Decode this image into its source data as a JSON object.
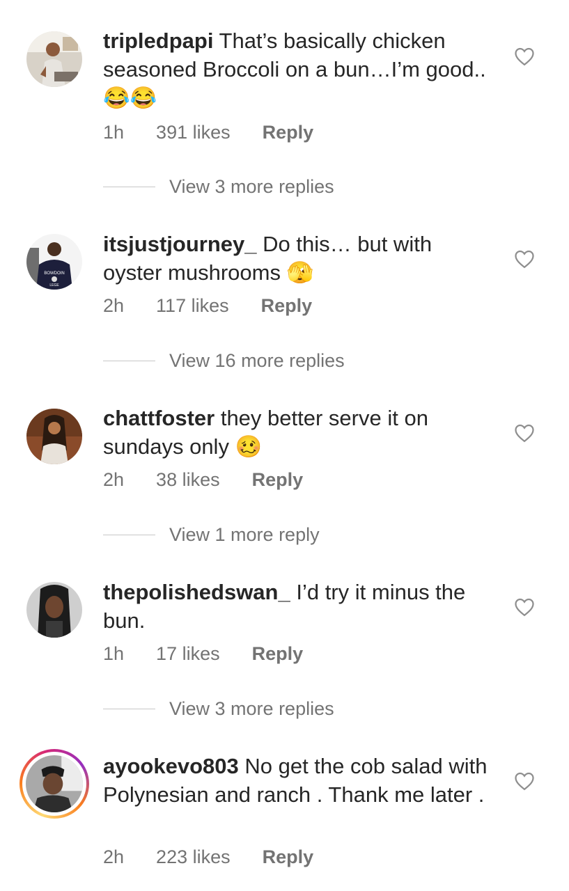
{
  "comments": [
    {
      "username": "tripledpapi",
      "text": "That’s basically chicken seasoned Broccoli on a bun…I’m good..",
      "emoji": "😂😂",
      "time": "1h",
      "likes": "391 likes",
      "reply": "Reply",
      "view_replies": "View 3 more replies",
      "heart_icon": "heart-outline-icon"
    },
    {
      "username": "itsjustjourney_",
      "text": "Do this… but with oyster mushrooms",
      "emoji": "🫣",
      "time": "2h",
      "likes": "117 likes",
      "reply": "Reply",
      "view_replies": "View 16 more replies",
      "heart_icon": "heart-outline-icon"
    },
    {
      "username": "chattfoster",
      "text": "they better serve it on sundays only",
      "emoji": "🥴",
      "time": "2h",
      "likes": "38 likes",
      "reply": "Reply",
      "view_replies": "View 1 more reply",
      "heart_icon": "heart-outline-icon"
    },
    {
      "username": "thepolishedswan_",
      "text": "I’d try it minus the bun.",
      "time": "1h",
      "likes": "17 likes",
      "reply": "Reply",
      "view_replies": "View 3 more replies",
      "heart_icon": "heart-outline-icon"
    },
    {
      "username": "ayookevo803",
      "text": "No get the cob salad with Polynesian and ranch . Thank me later .",
      "time": "2h",
      "likes": "223 likes",
      "reply": "Reply",
      "heart_icon": "heart-outline-icon"
    }
  ],
  "colors": {
    "text": "#262626",
    "secondary": "#737373",
    "divider": "#c7c7c7",
    "story_ring": [
      "#feda75",
      "#fa7e1e",
      "#d62976",
      "#962fbf"
    ]
  }
}
